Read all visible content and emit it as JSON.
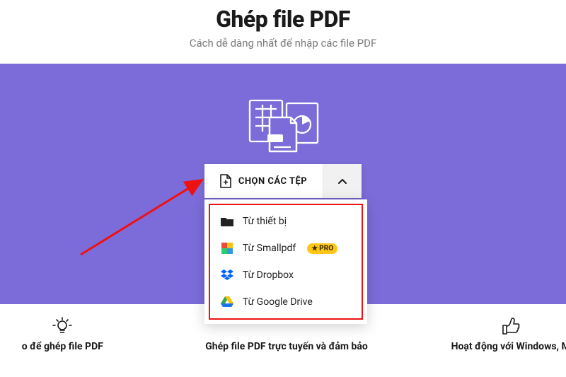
{
  "header": {
    "title": "Ghép file PDF",
    "subtitle": "Cách dễ dàng nhất để nhập các file PDF"
  },
  "chooser": {
    "button_label": "CHỌN CÁC TỆP"
  },
  "dropdown": {
    "items": [
      {
        "label": "Từ thiết bị"
      },
      {
        "label": "Từ Smallpdf"
      },
      {
        "label": "Từ Dropbox"
      },
      {
        "label": "Từ Google Drive"
      }
    ],
    "pro_badge": "PRO"
  },
  "features": {
    "left": "o để ghép file PDF",
    "center": "Ghép file PDF trực tuyến và đảm bảo",
    "right": "Hoạt động với Windows, M"
  }
}
